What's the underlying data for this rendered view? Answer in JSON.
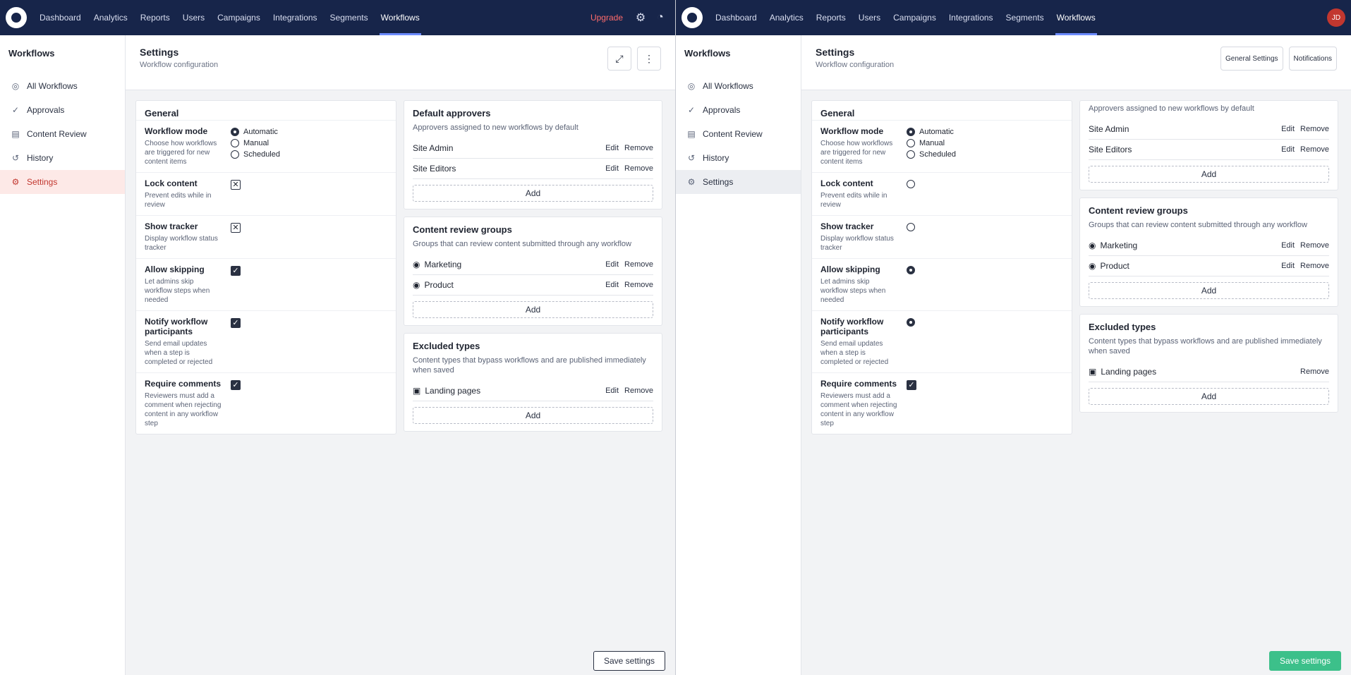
{
  "nav": {
    "items": [
      "Dashboard",
      "Analytics",
      "Reports",
      "Users",
      "Campaigns",
      "Integrations",
      "Segments",
      "Workflows"
    ],
    "active_index": 7,
    "alert": "Upgrade",
    "general_settings_label": "General Settings",
    "notifications_label": "Notifications",
    "avatar_initials": "JD"
  },
  "sidebar": {
    "title": "Workflows",
    "items": [
      {
        "label": "All Workflows",
        "icon": "◎"
      },
      {
        "label": "Approvals",
        "icon": "✓"
      },
      {
        "label": "Content Review",
        "icon": "▤"
      },
      {
        "label": "History",
        "icon": "↺"
      },
      {
        "label": "Settings",
        "icon": "⚙"
      }
    ],
    "active_index": 4
  },
  "header": {
    "title": "Settings",
    "subtitle": "Workflow configuration"
  },
  "general": {
    "title": "General",
    "settings": [
      {
        "name": "Workflow mode",
        "help": "Choose how workflows are triggered for new content items",
        "control": "radio",
        "options": [
          "Automatic",
          "Manual",
          "Scheduled"
        ],
        "selected": 0
      },
      {
        "name": "Lock content",
        "help": "Prevent edits while in review",
        "control": "check",
        "checked": false
      },
      {
        "name": "Show tracker",
        "help": "Display workflow status tracker",
        "control": "check",
        "checked": false
      },
      {
        "name": "Allow skipping",
        "help": "Let admins skip workflow steps when needed",
        "control": "check",
        "checked": true
      },
      {
        "name": "Notify workflow participants",
        "help": "Send email updates when a step is completed or rejected",
        "control": "check",
        "checked": true
      },
      {
        "name": "Require comments",
        "help": "Reviewers must add a comment when rejecting content in any workflow step",
        "control": "check",
        "checked": true
      }
    ]
  },
  "default_approvers": {
    "title": "Default approvers",
    "desc": "Approvers assigned to new workflows by default",
    "rows": [
      "Site Admin",
      "Site Editors"
    ],
    "edit_label": "Edit",
    "remove_label": "Remove",
    "add_label": "Add"
  },
  "review_groups": {
    "title": "Content review groups",
    "desc": "Groups that can review content submitted through any workflow",
    "rows": [
      "Marketing",
      "Product"
    ],
    "edit_label": "Edit",
    "remove_label": "Remove",
    "add_label": "Add"
  },
  "exclusions": {
    "title": "Excluded types",
    "desc": "Content types that bypass workflows and are published immediately when saved",
    "rows": [
      "Landing pages"
    ],
    "edit_label": "Edit",
    "remove_label": "Remove",
    "add_label": "Add"
  },
  "footer": {
    "save_label": "Save settings"
  }
}
